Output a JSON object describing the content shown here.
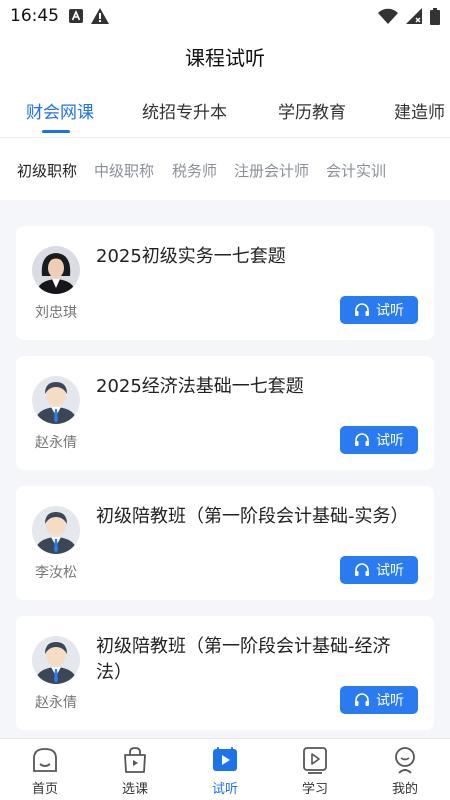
{
  "status_bar": {
    "time": "16:45",
    "left_icons": [
      "a-notification-icon",
      "warning-icon"
    ],
    "right_icons": [
      "wifi-icon",
      "signal-icon",
      "battery-icon"
    ]
  },
  "page": {
    "title": "课程试听"
  },
  "category_tabs": [
    {
      "label": "财会网课",
      "active": true
    },
    {
      "label": "统招专升本",
      "active": false
    },
    {
      "label": "学历教育",
      "active": false
    },
    {
      "label": "建造师",
      "active": false
    }
  ],
  "sub_tabs": [
    {
      "label": "初级职称",
      "active": true
    },
    {
      "label": "中级职称",
      "active": false
    },
    {
      "label": "税务师",
      "active": false
    },
    {
      "label": "注册会计师",
      "active": false
    },
    {
      "label": "会计实训",
      "active": false
    }
  ],
  "courses": [
    {
      "title": "2025初级实务一七套题",
      "teacher": "刘忠琪",
      "button": "试听",
      "avatar": "female-teacher-photo"
    },
    {
      "title": "2025经济法基础一七套题",
      "teacher": "赵永倩",
      "button": "试听",
      "avatar": "default-male-avatar"
    },
    {
      "title": "初级陪教班（第一阶段会计基础-实务）",
      "teacher": "李汝松",
      "button": "试听",
      "avatar": "default-male-avatar"
    },
    {
      "title": "初级陪教班（第一阶段会计基础-经济法）",
      "teacher": "赵永倩",
      "button": "试听",
      "avatar": "default-male-avatar"
    }
  ],
  "bottom_nav": [
    {
      "label": "首页",
      "icon": "home-icon",
      "active": false
    },
    {
      "label": "选课",
      "icon": "bag-icon",
      "active": false
    },
    {
      "label": "试听",
      "icon": "play-icon",
      "active": true
    },
    {
      "label": "学习",
      "icon": "video-icon",
      "active": false
    },
    {
      "label": "我的",
      "icon": "profile-icon",
      "active": false
    }
  ],
  "colors": {
    "accent": "#1e73e8",
    "button": "#2a7af0",
    "list_background": "#f4f6fa"
  }
}
